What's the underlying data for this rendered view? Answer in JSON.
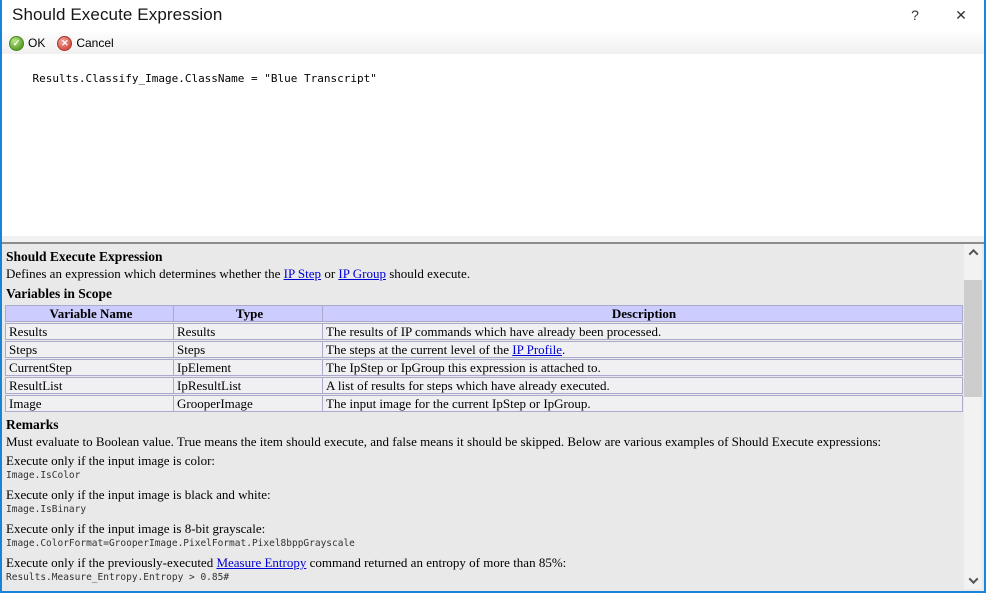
{
  "window": {
    "title": "Should Execute Expression",
    "help_glyph": "?",
    "close_glyph": "✕"
  },
  "toolbar": {
    "ok_label": "OK",
    "cancel_label": "Cancel",
    "ok_glyph": "✓",
    "cancel_glyph": "✕"
  },
  "editor": {
    "code": "Results.Classify_Image.ClassName = \"Blue Transcript\""
  },
  "help": {
    "heading": "Should Execute Expression",
    "intro": {
      "segments": [
        {
          "text": "Defines an expression which determines whether the "
        },
        {
          "link": "IP Step"
        },
        {
          "text": " or "
        },
        {
          "link": "IP Group"
        },
        {
          "text": " should execute."
        }
      ]
    },
    "variables_heading": "Variables in Scope",
    "table": {
      "headers": [
        "Variable Name",
        "Type",
        "Description"
      ],
      "rows": [
        {
          "name": "Results",
          "type": "Results",
          "desc": [
            {
              "text": "The results of IP commands which have already been processed."
            }
          ]
        },
        {
          "name": "Steps",
          "type": "Steps",
          "desc": [
            {
              "text": "The steps at the current level of the "
            },
            {
              "link": "IP Profile"
            },
            {
              "text": "."
            }
          ]
        },
        {
          "name": "CurrentStep",
          "type": "IpElement",
          "desc": [
            {
              "text": "The IpStep or IpGroup this expression is attached to."
            }
          ]
        },
        {
          "name": "ResultList",
          "type": "IpResultList",
          "desc": [
            {
              "text": "A list of results for steps which have already executed."
            }
          ]
        },
        {
          "name": "Image",
          "type": "GrooperImage",
          "desc": [
            {
              "text": "The input image for the current IpStep or IpGroup."
            }
          ]
        }
      ]
    },
    "remarks_heading": "Remarks",
    "remarks": "Must evaluate to Boolean value. True means the item should execute, and false means it should be skipped. Below are various examples of Should Execute expressions:",
    "examples": [
      {
        "label": [
          {
            "text": "Execute only if the input image is color:"
          }
        ],
        "code": "Image.IsColor"
      },
      {
        "label": [
          {
            "text": "Execute only if the input image is black and white:"
          }
        ],
        "code": "Image.IsBinary"
      },
      {
        "label": [
          {
            "text": "Execute only if the input image is 8-bit grayscale:"
          }
        ],
        "code": "Image.ColorFormat=GrooperImage.PixelFormat.Pixel8bppGrayscale"
      },
      {
        "label": [
          {
            "text": "Execute only if the previously-executed "
          },
          {
            "link": "Measure Entropy"
          },
          {
            "text": " command returned an entropy of more than 85%:"
          }
        ],
        "code": "Results.Measure_Entropy.Entropy > 0.85#"
      }
    ]
  },
  "colors": {
    "window_border": "#1883d7",
    "link": "#0000d4",
    "table_header_bg": "#ccccff",
    "table_row_bg": "#f0f0f3",
    "table_border": "#aaaacc",
    "ok_green": "#5ea32c",
    "cancel_red": "#d9534a",
    "panel_bg": "#e9e9e9",
    "scroll_thumb": "#cdcdcd"
  }
}
